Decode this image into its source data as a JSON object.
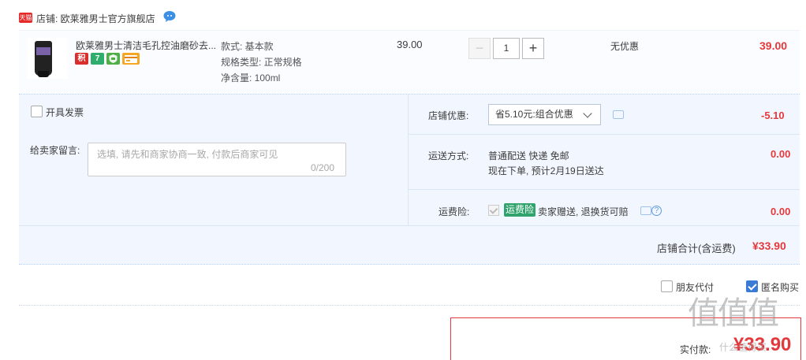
{
  "store": {
    "badge": "天猫",
    "label": "店铺: 欧莱雅男士官方旗舰店"
  },
  "item": {
    "title": "欧莱雅男士清洁毛孔控油磨砂去...",
    "tags": [
      "积",
      "7",
      "",
      ""
    ],
    "sku": {
      "style": "款式: 基本款",
      "spec": "规格类型: 正常规格",
      "volume": "净含量: 100ml"
    },
    "unit_price": "39.00",
    "quantity": "1",
    "minus": "−",
    "plus": "+",
    "promo": "无优惠",
    "total": "39.00"
  },
  "options": {
    "invoice_label": "开具发票",
    "message_label": "给卖家留言:",
    "message_placeholder": "选填, 请先和商家协商一致, 付款后商家可见",
    "message_count": "0/200",
    "store_discount_label": "店铺优惠:",
    "store_discount_value": "省5.10元:组合优惠",
    "store_discount_amount": "-5.10",
    "shipping_label": "运送方式:",
    "shipping_line1": "普通配送 快递 免邮",
    "shipping_line2": "现在下单, 预计2月19日送达",
    "shipping_amount": "0.00",
    "insurance_label": "运费险:",
    "insurance_badge": "运费险",
    "insurance_text": "卖家赠送, 退换货可赔",
    "insurance_amount": "0.00",
    "store_total_label": "店铺合计(含运费)",
    "store_total_value": "¥33.90"
  },
  "footer": {
    "friend_pay": "朋友代付",
    "anonymous": "匿名购买",
    "pay_label": "实付款:",
    "pay_amount": "¥33.90"
  },
  "watermark": {
    "text": "值值值",
    "sub": "什么值得买"
  },
  "colors": {
    "accent_red": "#e4393c",
    "panel_bg": "#f2f7ff",
    "check_blue": "#3a7bd5"
  }
}
